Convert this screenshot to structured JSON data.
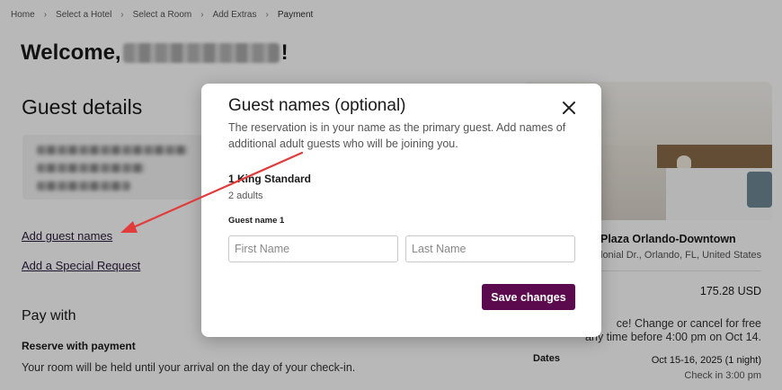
{
  "breadcrumb": {
    "items": [
      "Home",
      "Select a Hotel",
      "Select a Room",
      "Add Extras",
      "Payment"
    ]
  },
  "welcome": {
    "prefix": "Welcome,",
    "suffix": "!"
  },
  "guest_details": {
    "title": "Guest details",
    "add_guest_names_link": "Add guest names",
    "add_special_request_link": "Add a Special Request"
  },
  "pay_with": {
    "title": "Pay with",
    "option_title": "Reserve with payment",
    "option_desc": "Your room will be held until your arrival on the day of your check-in."
  },
  "hotel": {
    "name_visible": "Plaza Orlando-Downtown",
    "address_visible": "lonial Dr., Orlando, FL, United States",
    "price": "175.28 USD",
    "policy_line1": "ce! Change or cancel for free",
    "policy_line2": "any time before 4:00 pm on Oct 14.",
    "dates_label": "Dates",
    "dates_value": "Oct 15-16, 2025 (1 night)",
    "checkin": "Check in 3:00 pm"
  },
  "modal": {
    "title": "Guest names (optional)",
    "description": "The reservation is in your name as the primary guest. Add names of additional adult guests who will be joining you.",
    "room_name": "1 King Standard",
    "room_guests": "2 adults",
    "guest_label": "Guest name 1",
    "first_name_placeholder": "First Name",
    "last_name_placeholder": "Last Name",
    "save_label": "Save changes"
  },
  "colors": {
    "accent": "#5a0a4d",
    "annotation_arrow": "#e23b3b",
    "overlay": "rgba(0,0,0,0.28)"
  },
  "icons": {
    "breadcrumb_separator": "chevron-right-icon",
    "modal_close": "close-icon"
  }
}
